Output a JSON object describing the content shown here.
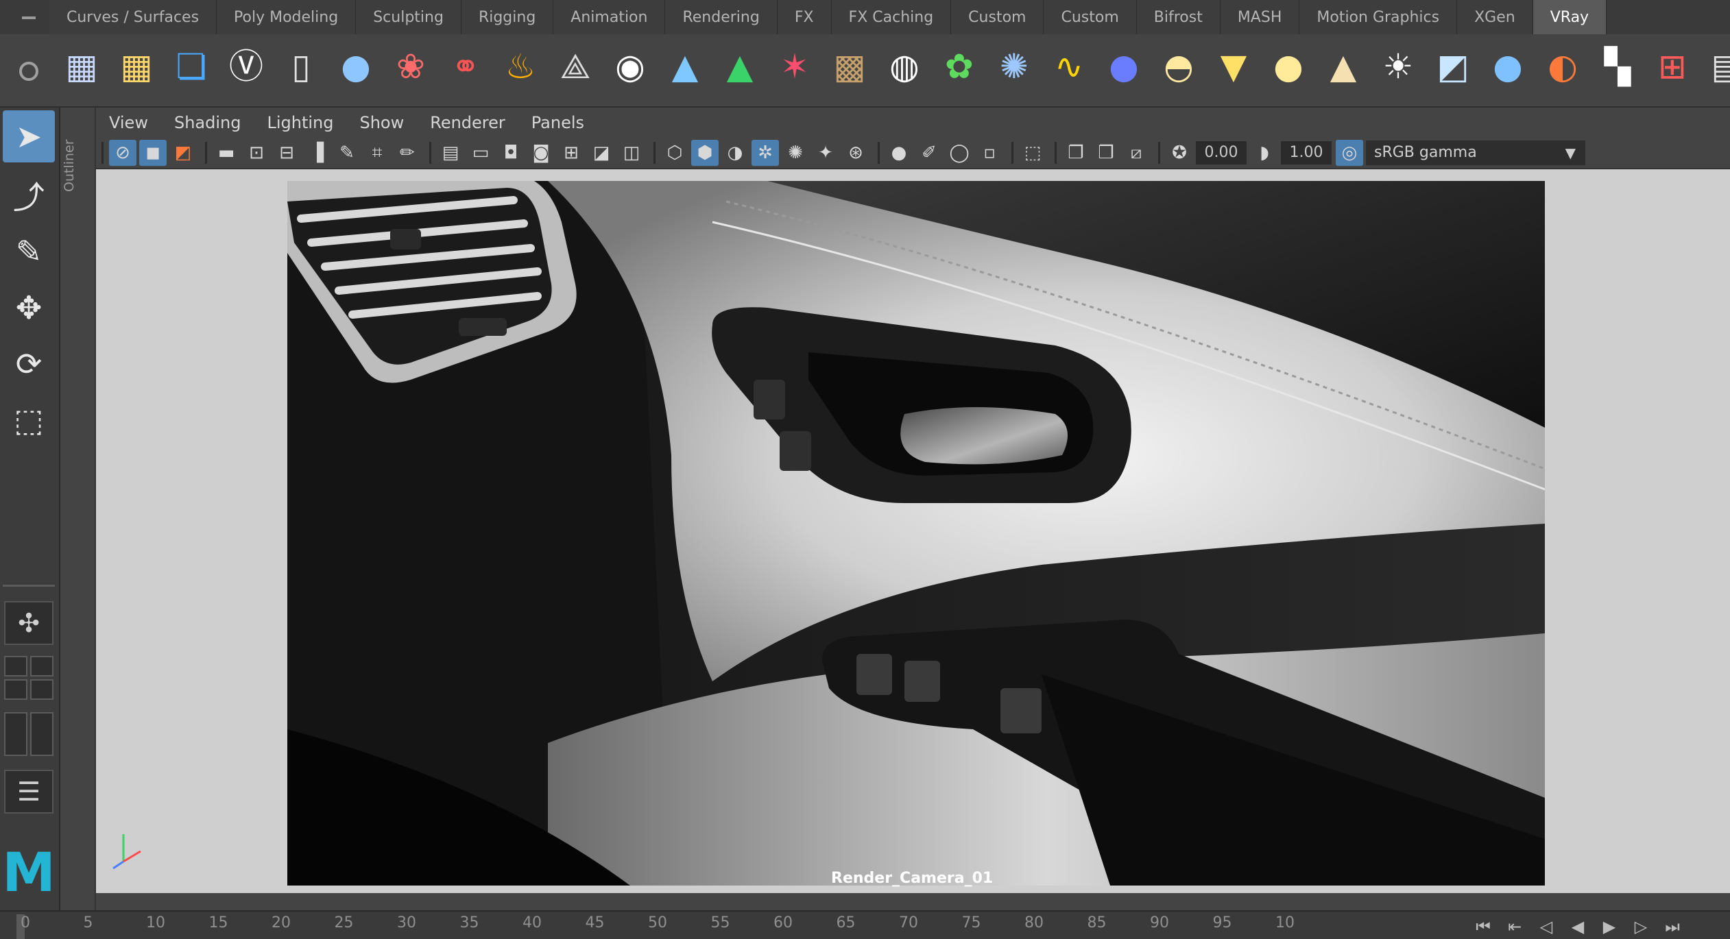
{
  "shelf": {
    "tabs": [
      {
        "label": "Curves / Surfaces"
      },
      {
        "label": "Poly Modeling"
      },
      {
        "label": "Sculpting"
      },
      {
        "label": "Rigging"
      },
      {
        "label": "Animation"
      },
      {
        "label": "Rendering"
      },
      {
        "label": "FX"
      },
      {
        "label": "FX Caching"
      },
      {
        "label": "Custom"
      },
      {
        "label": "Custom"
      },
      {
        "label": "Bifrost"
      },
      {
        "label": "MASH"
      },
      {
        "label": "Motion Graphics"
      },
      {
        "label": "XGen"
      },
      {
        "label": "VRay",
        "active": true
      }
    ],
    "icons": [
      {
        "name": "vray-settings-grid-icon",
        "glyph": "▦",
        "color": "#c8d8ff"
      },
      {
        "name": "vray-settings-grid-2-icon",
        "glyph": "▦",
        "color": "#ffd66a"
      },
      {
        "name": "vray-frame-buffer-icon",
        "glyph": "❏",
        "color": "#4aa8ff"
      },
      {
        "name": "vray-logo-icon",
        "glyph": "Ⓥ",
        "color": "#ffffff"
      },
      {
        "name": "vray-device-icon",
        "glyph": "▯",
        "color": "#e0e0e0"
      },
      {
        "name": "vray-globe-light-icon",
        "glyph": "●",
        "color": "#8ec7ff"
      },
      {
        "name": "vray-proxy-icon",
        "glyph": "❀",
        "color": "#ff6b6b"
      },
      {
        "name": "vray-molecule-icon",
        "glyph": "⚭",
        "color": "#ff5555"
      },
      {
        "name": "vray-fire-icon",
        "glyph": "♨",
        "color": "#ffae00"
      },
      {
        "name": "vray-mesh-icon",
        "glyph": "⟁",
        "color": "#dddddd"
      },
      {
        "name": "vray-sphere-button-icon",
        "glyph": "◉",
        "color": "#ffffff"
      },
      {
        "name": "vray-drop-icon",
        "glyph": "▲",
        "color": "#7ec8ff"
      },
      {
        "name": "vray-aerial-icon",
        "glyph": "▲",
        "color": "#3ad36a"
      },
      {
        "name": "vray-fur-icon",
        "glyph": "✶",
        "color": "#ff4d6d"
      },
      {
        "name": "vray-texture-wood-icon",
        "glyph": "▩",
        "color": "#c7a16b"
      },
      {
        "name": "vray-dome-sphere-icon",
        "glyph": "◍",
        "color": "#ffffff"
      },
      {
        "name": "vray-grass-icon",
        "glyph": "✿",
        "color": "#5edb5e"
      },
      {
        "name": "vray-snow-flake-icon",
        "glyph": "✺",
        "color": "#9cc8ff"
      },
      {
        "name": "vray-hair-curve-icon",
        "glyph": "∿",
        "color": "#ffd400"
      },
      {
        "name": "vray-ball-blue-icon",
        "glyph": "●",
        "color": "#6a7cff"
      },
      {
        "name": "vray-dome-light-icon",
        "glyph": "◓",
        "color": "#ffe8a0"
      },
      {
        "name": "vray-spot-light-icon",
        "glyph": "▼",
        "color": "#ffe066"
      },
      {
        "name": "vray-sphere-light-icon",
        "glyph": "●",
        "color": "#ffeb99"
      },
      {
        "name": "vray-ies-light-icon",
        "glyph": "▲",
        "color": "#f4e0b0"
      },
      {
        "name": "vray-sun-icon",
        "glyph": "☀",
        "color": "#ffffff"
      },
      {
        "name": "vray-plane-light-icon",
        "glyph": "◩",
        "color": "#c8e6ff"
      },
      {
        "name": "vray-material-sphere-icon",
        "glyph": "●",
        "color": "#7fc0ff"
      },
      {
        "name": "vray-material-multi-icon",
        "glyph": "◐",
        "color": "#ff7a3a"
      },
      {
        "name": "vray-checker-icon",
        "glyph": "▚",
        "color": "#ffffff"
      },
      {
        "name": "vray-render-view-icon",
        "glyph": "⊞",
        "color": "#ff5a5a"
      },
      {
        "name": "vray-render-window-icon",
        "glyph": "▤",
        "color": "#e0e0e0"
      }
    ]
  },
  "panel": {
    "menu": [
      "View",
      "Shading",
      "Lighting",
      "Show",
      "Renderer",
      "Panels"
    ],
    "toolbar": {
      "exposure_value": "0.00",
      "gamma_value": "1.00",
      "color_management": "sRGB gamma"
    }
  },
  "outliner": {
    "label": "Outliner"
  },
  "viewport": {
    "camera": "Render_Camera_01"
  },
  "timeline": {
    "ticks": [
      "0",
      "5",
      "10",
      "15",
      "20",
      "25",
      "30",
      "35",
      "40",
      "45",
      "50",
      "55",
      "60",
      "65",
      "70",
      "75",
      "80",
      "85",
      "90",
      "95",
      "10"
    ],
    "current_frame": 0
  },
  "colors": {
    "accent": "#5a8fbf",
    "maya_logo": "#25b5d4"
  }
}
